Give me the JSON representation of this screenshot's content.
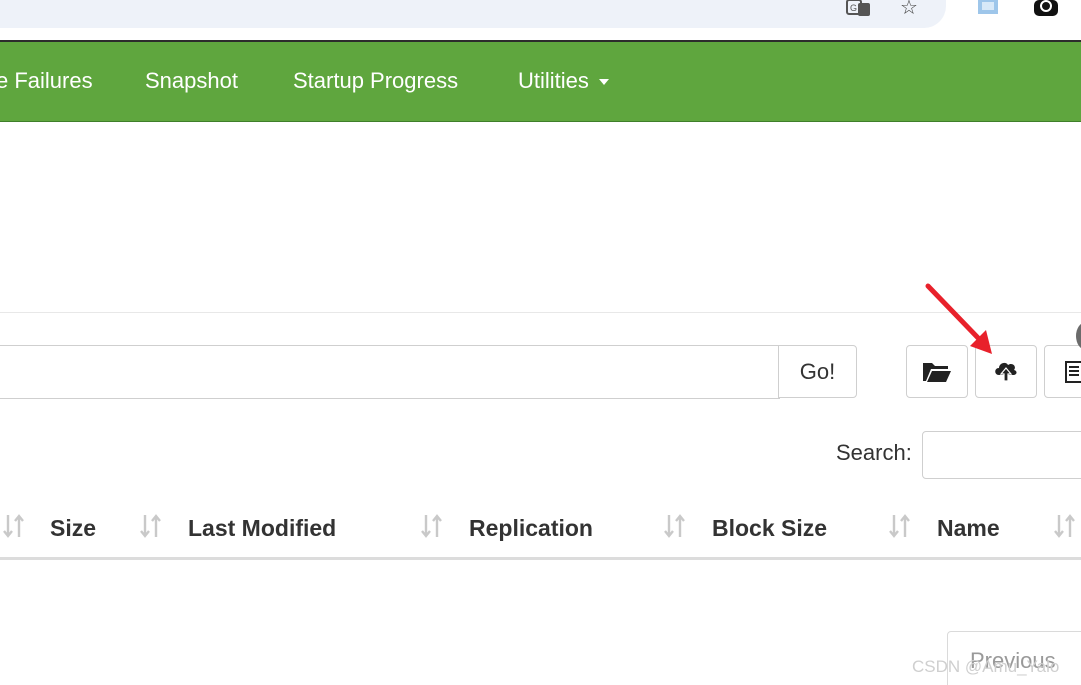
{
  "navbar": {
    "items": [
      {
        "label": "e Failures"
      },
      {
        "label": "Snapshot"
      },
      {
        "label": "Startup Progress"
      },
      {
        "label": "Utilities"
      }
    ]
  },
  "browse": {
    "path_value": "",
    "go_label": "Go!",
    "search_label": "Search:",
    "search_value": ""
  },
  "table": {
    "columns": [
      "Size",
      "Last Modified",
      "Replication",
      "Block Size",
      "Name"
    ]
  },
  "pagination": {
    "previous_label": "Previous"
  },
  "watermark": "CSDN @Amu_Yalo",
  "colors": {
    "navbar": "#5fa63e",
    "annotation_arrow": "#e8212b"
  },
  "icons": {
    "folder": "folder-open-icon",
    "upload": "cloud-upload-icon",
    "list": "list-icon",
    "sort": "sort-icon"
  }
}
